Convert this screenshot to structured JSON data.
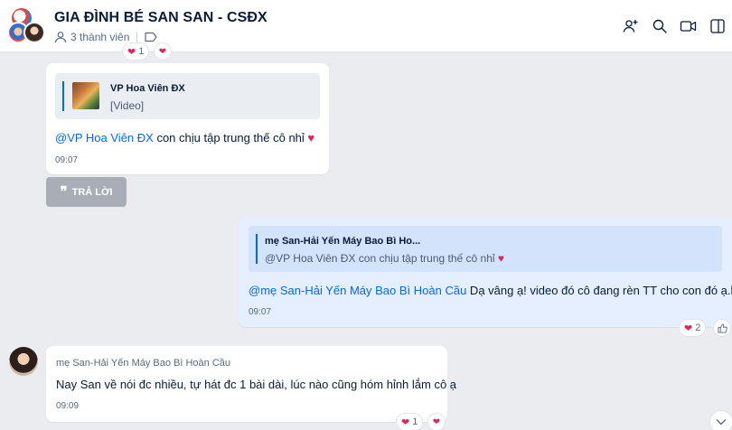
{
  "header": {
    "title": "GIA ĐÌNH BÉ SAN SAN - CSĐX",
    "members": "3 thành viên",
    "actions": [
      "add-member-icon",
      "search-icon",
      "video-call-icon",
      "sidebar-toggle-icon"
    ]
  },
  "messages": [
    {
      "quote": {
        "name": "VP Hoa Viên ĐX",
        "text": "[Video]"
      },
      "mention": "@VP  Hoa Viên  ĐX",
      "text": " con chịu tập trung thế cô nhỉ",
      "time": "09:07"
    },
    {
      "quote": {
        "name": "mẹ San-Hải Yến Máy Bao Bì Ho...",
        "text": "@VP Hoa Viên ĐX con chịu tập trung thế cô nhỉ"
      },
      "mention": "@mẹ San-Hải Yến Máy Bao Bì Hoàn Cầu",
      "text": " Dạ vâng ạ! video đó cô đang rèn TT cho con đó ạ.hjhj",
      "time": "09:07",
      "reaction_count": "2"
    },
    {
      "sender": "mẹ San-Hải Yến Máy Bao Bì Hoàn Cầu",
      "text": "Nay San về nói đc nhiều, tự hát đc 1 bài dài, lúc nào cũng hóm hỉnh lắm cô ạ",
      "time": "09:09",
      "reaction_count": "1"
    }
  ],
  "top_reaction_count": "1",
  "reply_label": "TRẢ LỜI",
  "colors": {
    "accent": "#0068ff",
    "heart": "#e0245e",
    "self_bubble": "#e5efff"
  }
}
